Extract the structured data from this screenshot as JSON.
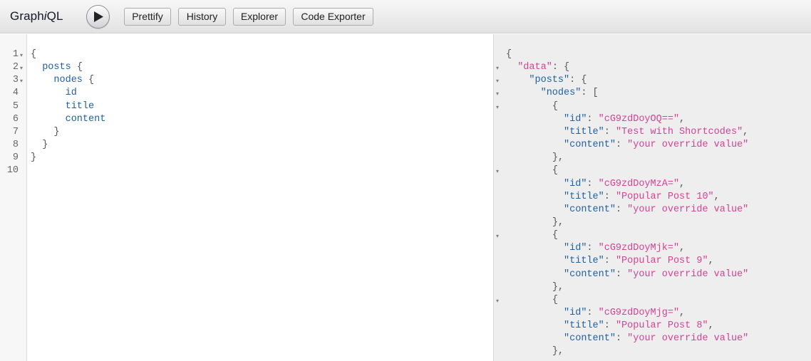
{
  "header": {
    "title_prefix": "Graph",
    "title_italic": "i",
    "title_suffix": "QL",
    "execute_icon": "play-icon",
    "buttons": {
      "prettify": "Prettify",
      "history": "History",
      "explorer": "Explorer",
      "code_exporter": "Code Exporter"
    }
  },
  "query_editor": {
    "line_numbers": [
      "1",
      "2",
      "3",
      "4",
      "5",
      "6",
      "7",
      "8",
      "9",
      "10"
    ],
    "lines": [
      [
        {
          "t": "{",
          "c": "punct"
        }
      ],
      [
        {
          "t": "  "
        },
        {
          "t": "posts",
          "c": "field"
        },
        {
          "t": " {",
          "c": "punct"
        }
      ],
      [
        {
          "t": "    "
        },
        {
          "t": "nodes",
          "c": "field"
        },
        {
          "t": " {",
          "c": "punct"
        }
      ],
      [
        {
          "t": "      "
        },
        {
          "t": "id",
          "c": "field"
        }
      ],
      [
        {
          "t": "      "
        },
        {
          "t": "title",
          "c": "field"
        }
      ],
      [
        {
          "t": "      "
        },
        {
          "t": "content",
          "c": "field"
        }
      ],
      [
        {
          "t": "    "
        },
        {
          "t": "}",
          "c": "punct"
        }
      ],
      [
        {
          "t": "  "
        },
        {
          "t": "}",
          "c": "punct"
        }
      ],
      [
        {
          "t": "}",
          "c": "punct"
        }
      ],
      [
        {
          "t": ""
        }
      ]
    ]
  },
  "result_viewer": {
    "lines": [
      [
        {
          "t": "{",
          "c": "punct"
        }
      ],
      [
        {
          "t": "  "
        },
        {
          "t": "\"data\"",
          "c": "str"
        },
        {
          "t": ": {",
          "c": "punct"
        }
      ],
      [
        {
          "t": "    "
        },
        {
          "t": "\"posts\"",
          "c": "prop"
        },
        {
          "t": ": {",
          "c": "punct"
        }
      ],
      [
        {
          "t": "      "
        },
        {
          "t": "\"nodes\"",
          "c": "prop"
        },
        {
          "t": ": [",
          "c": "punct"
        }
      ],
      [
        {
          "t": "        "
        },
        {
          "t": "{",
          "c": "punct"
        }
      ],
      [
        {
          "t": "          "
        },
        {
          "t": "\"id\"",
          "c": "prop"
        },
        {
          "t": ": ",
          "c": "punct"
        },
        {
          "t": "\"cG9zdDoyOQ==\"",
          "c": "str"
        },
        {
          "t": ",",
          "c": "punct"
        }
      ],
      [
        {
          "t": "          "
        },
        {
          "t": "\"title\"",
          "c": "prop"
        },
        {
          "t": ": ",
          "c": "punct"
        },
        {
          "t": "\"Test with Shortcodes\"",
          "c": "str"
        },
        {
          "t": ",",
          "c": "punct"
        }
      ],
      [
        {
          "t": "          "
        },
        {
          "t": "\"content\"",
          "c": "prop"
        },
        {
          "t": ": ",
          "c": "punct"
        },
        {
          "t": "\"your override value\"",
          "c": "str"
        }
      ],
      [
        {
          "t": "        "
        },
        {
          "t": "},",
          "c": "punct"
        }
      ],
      [
        {
          "t": "        "
        },
        {
          "t": "{",
          "c": "punct"
        }
      ],
      [
        {
          "t": "          "
        },
        {
          "t": "\"id\"",
          "c": "prop"
        },
        {
          "t": ": ",
          "c": "punct"
        },
        {
          "t": "\"cG9zdDoyMzA=\"",
          "c": "str"
        },
        {
          "t": ",",
          "c": "punct"
        }
      ],
      [
        {
          "t": "          "
        },
        {
          "t": "\"title\"",
          "c": "prop"
        },
        {
          "t": ": ",
          "c": "punct"
        },
        {
          "t": "\"Popular Post 10\"",
          "c": "str"
        },
        {
          "t": ",",
          "c": "punct"
        }
      ],
      [
        {
          "t": "          "
        },
        {
          "t": "\"content\"",
          "c": "prop"
        },
        {
          "t": ": ",
          "c": "punct"
        },
        {
          "t": "\"your override value\"",
          "c": "str"
        }
      ],
      [
        {
          "t": "        "
        },
        {
          "t": "},",
          "c": "punct"
        }
      ],
      [
        {
          "t": "        "
        },
        {
          "t": "{",
          "c": "punct"
        }
      ],
      [
        {
          "t": "          "
        },
        {
          "t": "\"id\"",
          "c": "prop"
        },
        {
          "t": ": ",
          "c": "punct"
        },
        {
          "t": "\"cG9zdDoyMjk=\"",
          "c": "str"
        },
        {
          "t": ",",
          "c": "punct"
        }
      ],
      [
        {
          "t": "          "
        },
        {
          "t": "\"title\"",
          "c": "prop"
        },
        {
          "t": ": ",
          "c": "punct"
        },
        {
          "t": "\"Popular Post 9\"",
          "c": "str"
        },
        {
          "t": ",",
          "c": "punct"
        }
      ],
      [
        {
          "t": "          "
        },
        {
          "t": "\"content\"",
          "c": "prop"
        },
        {
          "t": ": ",
          "c": "punct"
        },
        {
          "t": "\"your override value\"",
          "c": "str"
        }
      ],
      [
        {
          "t": "        "
        },
        {
          "t": "},",
          "c": "punct"
        }
      ],
      [
        {
          "t": "        "
        },
        {
          "t": "{",
          "c": "punct"
        }
      ],
      [
        {
          "t": "          "
        },
        {
          "t": "\"id\"",
          "c": "prop"
        },
        {
          "t": ": ",
          "c": "punct"
        },
        {
          "t": "\"cG9zdDoyMjg=\"",
          "c": "str"
        },
        {
          "t": ",",
          "c": "punct"
        }
      ],
      [
        {
          "t": "          "
        },
        {
          "t": "\"title\"",
          "c": "prop"
        },
        {
          "t": ": ",
          "c": "punct"
        },
        {
          "t": "\"Popular Post 8\"",
          "c": "str"
        },
        {
          "t": ",",
          "c": "punct"
        }
      ],
      [
        {
          "t": "          "
        },
        {
          "t": "\"content\"",
          "c": "prop"
        },
        {
          "t": ": ",
          "c": "punct"
        },
        {
          "t": "\"your override value\"",
          "c": "str"
        }
      ],
      [
        {
          "t": "        "
        },
        {
          "t": "},",
          "c": "punct"
        }
      ]
    ]
  },
  "colors": {
    "field": "#1f61a0",
    "string": "#d64292",
    "punctuation": "#555555"
  }
}
